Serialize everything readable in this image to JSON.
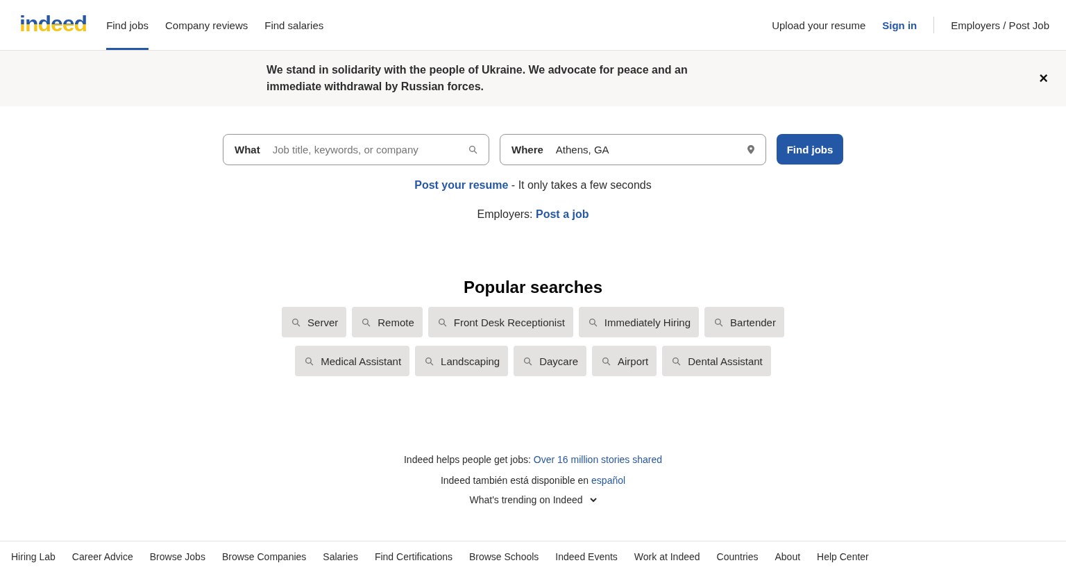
{
  "header": {
    "logo": "indeed",
    "nav": [
      {
        "label": "Find jobs",
        "selected": true
      },
      {
        "label": "Company reviews",
        "selected": false
      },
      {
        "label": "Find salaries",
        "selected": false
      }
    ],
    "right": {
      "upload": "Upload your resume",
      "sign_in": "Sign in",
      "employers": "Employers / Post Job"
    }
  },
  "banner": {
    "text": "We stand in solidarity with the people of Ukraine. We advocate for peace and an immediate withdrawal by Russian forces.",
    "close": "×"
  },
  "search": {
    "what": {
      "label": "What",
      "placeholder": "Job title, keywords, or company"
    },
    "where": {
      "label": "Where",
      "value": "Athens, GA"
    },
    "button": "Find jobs"
  },
  "resume": {
    "link": "Post your resume",
    "text": "- It only takes a few seconds"
  },
  "employers": {
    "text": "Employers:",
    "link": "Post a job"
  },
  "popular": {
    "title": "Popular searches",
    "searches": [
      "Server",
      "Remote",
      "Front Desk Receptionist",
      "Immediately Hiring",
      "Bartender",
      "Medical Assistant",
      "Landscaping",
      "Daycare",
      "Airport",
      "Dental Assistant"
    ]
  },
  "info": [
    {
      "text": "Indeed helps people get jobs:",
      "link": "Over 16 million stories shared"
    },
    {
      "text": "Indeed también está disponible en",
      "link": "español"
    }
  ],
  "trending": "What's trending on Indeed",
  "footer": [
    "Hiring Lab",
    "Career Advice",
    "Browse Jobs",
    "Browse Companies",
    "Salaries",
    "Find Certifications",
    "Browse Schools",
    "Indeed Events",
    "Work at Indeed",
    "Countries",
    "About",
    "Help Center"
  ]
}
